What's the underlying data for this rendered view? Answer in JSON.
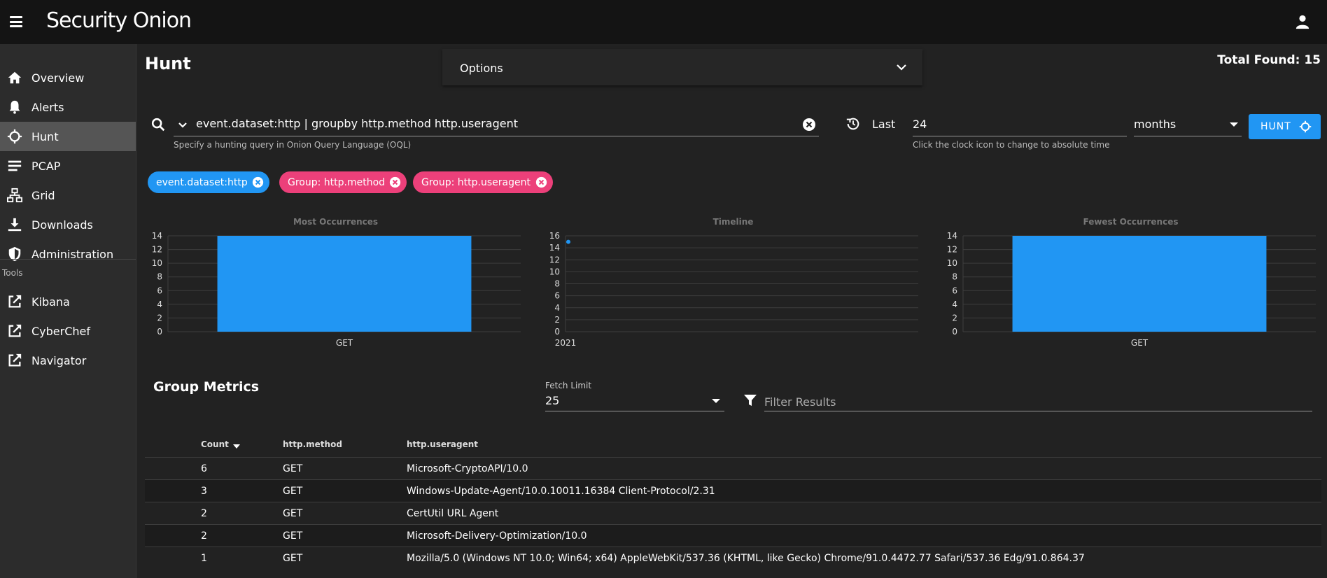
{
  "header": {
    "menu_icon": "hamburger-icon",
    "logo": "Security Onion",
    "user_icon": "user-icon"
  },
  "sidebar": {
    "items": [
      {
        "label": "Overview",
        "icon": "home-icon"
      },
      {
        "label": "Alerts",
        "icon": "bell-icon"
      },
      {
        "label": "Hunt",
        "icon": "crosshair-icon",
        "active": true
      },
      {
        "label": "PCAP",
        "icon": "list-icon"
      },
      {
        "label": "Grid",
        "icon": "network-icon"
      },
      {
        "label": "Downloads",
        "icon": "download-icon"
      },
      {
        "label": "Administration",
        "icon": "shield-icon"
      }
    ],
    "tools_label": "Tools",
    "tools": [
      {
        "label": "Kibana",
        "icon": "external-link-icon"
      },
      {
        "label": "CyberChef",
        "icon": "external-link-icon"
      },
      {
        "label": "Navigator",
        "icon": "external-link-icon"
      }
    ]
  },
  "page": {
    "title": "Hunt",
    "options_label": "Options",
    "total_found": "Total Found: 15"
  },
  "query": {
    "value": "event.dataset:http | groupby http.method http.useragent",
    "hint": "Specify a hunting query in Onion Query Language (OQL)"
  },
  "time_range": {
    "last_label": "Last",
    "value": "24",
    "unit": "months",
    "hint": "Click the clock icon to change to absolute time"
  },
  "hunt_button": "HUNT",
  "chips": [
    {
      "label": "event.dataset:http",
      "color": "#2196f3"
    },
    {
      "label": "Group: http.method",
      "color": "#ec407a"
    },
    {
      "label": "Group: http.useragent",
      "color": "#ec407a"
    }
  ],
  "colors": {
    "accent": "#2196f3",
    "group_chip": "#ec407a"
  },
  "chart_data": [
    {
      "type": "bar",
      "title": "Most Occurrences",
      "categories": [
        "GET"
      ],
      "values": [
        14
      ],
      "ylim": [
        0,
        14
      ],
      "yticks": [
        "0",
        "2",
        "4",
        "6",
        "8",
        "10",
        "12",
        "14"
      ],
      "grid": true
    },
    {
      "type": "line",
      "title": "Timeline",
      "x": [
        "2021"
      ],
      "values": [
        15
      ],
      "ylim": [
        0,
        16
      ],
      "yticks": [
        "0",
        "2",
        "4",
        "6",
        "8",
        "10",
        "12",
        "14",
        "16"
      ],
      "grid": true
    },
    {
      "type": "bar",
      "title": "Fewest Occurrences",
      "categories": [
        "GET"
      ],
      "values": [
        14
      ],
      "ylim": [
        0,
        14
      ],
      "yticks": [
        "0",
        "2",
        "4",
        "6",
        "8",
        "10",
        "12",
        "14"
      ],
      "grid": true
    }
  ],
  "group_metrics": {
    "title": "Group Metrics",
    "fetch_limit_label": "Fetch Limit",
    "fetch_limit_value": "25",
    "filter_placeholder": "Filter Results",
    "columns": [
      "Count",
      "http.method",
      "http.useragent"
    ],
    "rows": [
      [
        "6",
        "GET",
        "Microsoft-CryptoAPI/10.0"
      ],
      [
        "3",
        "GET",
        "Windows-Update-Agent/10.0.10011.16384 Client-Protocol/2.31"
      ],
      [
        "2",
        "GET",
        "CertUtil URL Agent"
      ],
      [
        "2",
        "GET",
        "Microsoft-Delivery-Optimization/10.0"
      ],
      [
        "1",
        "GET",
        "Mozilla/5.0 (Windows NT 10.0; Win64; x64) AppleWebKit/537.36 (KHTML, like Gecko) Chrome/91.0.4472.77 Safari/537.36 Edg/91.0.864.37"
      ]
    ]
  }
}
